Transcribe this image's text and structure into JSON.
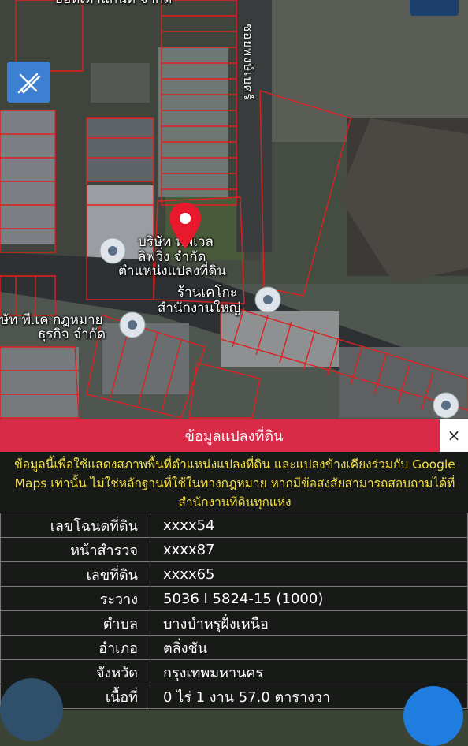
{
  "map": {
    "labels": {
      "top_company": "ยอห์เทาแกนท์ จำกัด",
      "company_a_line1": "บริษัท ทีพีเวล",
      "company_a_line2": "ลิฟวิ่ง จำกัด",
      "parcel_position": "ตำแหน่งแปลงที่ดิน",
      "shop_line1": "ร้านเคโกะ",
      "shop_line2": "สำนักงานใหญ่",
      "company_b_line1": "ษัท พี.เค กฎหมาย",
      "company_b_line2": "ธุรกิจ จำกัด",
      "road": "ซอยพงษ์เบศร์"
    },
    "icons": [
      "draw-tool-icon",
      "location-pin-icon",
      "poi-icon"
    ]
  },
  "panel": {
    "title": "ข้อมูลแปลงที่ดิน",
    "close": "×",
    "notice": "ข้อมูลนี้เพื่อใช้แสดงสภาพพื้นที่ตำแหน่งแปลงที่ดิน และแปลงข้างเคียงร่วมกับ Google Maps เท่านั้น ไม่ใช่หลักฐานที่ใช้ในทางกฎหมาย หากมีข้อสงสัยสามารถสอบถามได้ที่สำนักงานที่ดินทุกแห่ง",
    "rows": [
      {
        "label": "เลขโฉนดที่ดิน",
        "value": "xxxx54"
      },
      {
        "label": "หน้าสำรวจ",
        "value": "xxxx87"
      },
      {
        "label": "เลขที่ดิน",
        "value": "xxxx65"
      },
      {
        "label": "ระวาง",
        "value": "5036 I 5824-15 (1000)"
      },
      {
        "label": "ตำบล",
        "value": "บางบำหรุฝั่งเหนือ"
      },
      {
        "label": "อำเภอ",
        "value": "ตลิ่งชัน"
      },
      {
        "label": "จังหวัด",
        "value": "กรุงเทพมหานคร"
      },
      {
        "label": "เนื้อที่",
        "value": "0 ไร่ 1 งาน 57.0 ตารางวา"
      }
    ]
  },
  "colors": {
    "accent": "#d92a48",
    "notice": "#f3df48",
    "pin": "#e8192c",
    "tool": "#3d7fd1"
  }
}
